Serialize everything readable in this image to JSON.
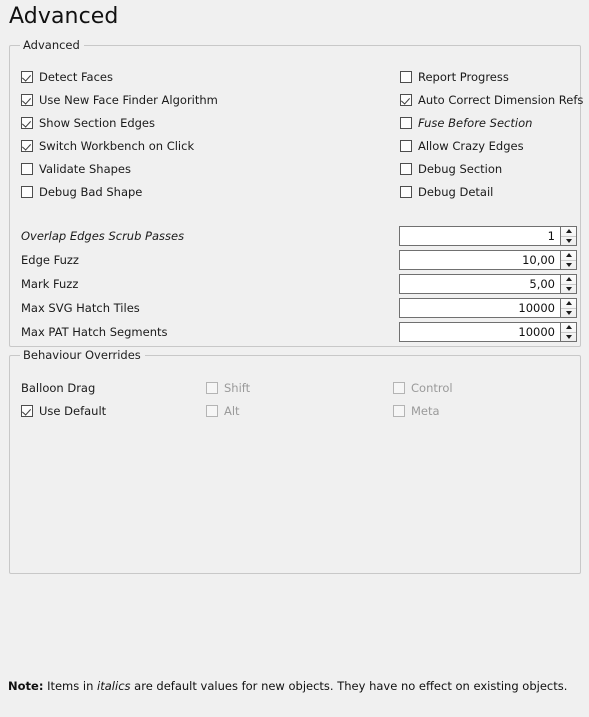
{
  "page": {
    "title": "Advanced"
  },
  "advanced_group": {
    "title": "Advanced",
    "checkboxes_left": [
      {
        "label": "Detect Faces",
        "checked": true,
        "italic": false,
        "disabled": false
      },
      {
        "label": "Use New Face Finder Algorithm",
        "checked": true,
        "italic": false,
        "disabled": false
      },
      {
        "label": "Show Section Edges",
        "checked": true,
        "italic": false,
        "disabled": false
      },
      {
        "label": "Switch Workbench on Click",
        "checked": true,
        "italic": false,
        "disabled": false
      },
      {
        "label": "Validate Shapes",
        "checked": false,
        "italic": false,
        "disabled": false
      },
      {
        "label": "Debug Bad Shape",
        "checked": false,
        "italic": false,
        "disabled": false
      }
    ],
    "checkboxes_right": [
      {
        "label": "Report Progress",
        "checked": false,
        "italic": false,
        "disabled": false
      },
      {
        "label": "Auto Correct Dimension Refs",
        "checked": true,
        "italic": false,
        "disabled": false
      },
      {
        "label": "Fuse Before Section",
        "checked": false,
        "italic": true,
        "disabled": false
      },
      {
        "label": "Allow Crazy Edges",
        "checked": false,
        "italic": false,
        "disabled": false
      },
      {
        "label": "Debug Section",
        "checked": false,
        "italic": false,
        "disabled": false
      },
      {
        "label": "Debug Detail",
        "checked": false,
        "italic": false,
        "disabled": false
      }
    ],
    "spin_fields": [
      {
        "label": "Overlap Edges Scrub Passes",
        "value": "1",
        "italic": true
      },
      {
        "label": "Edge Fuzz",
        "value": "10,00",
        "italic": false
      },
      {
        "label": "Mark Fuzz",
        "value": "5,00",
        "italic": false
      },
      {
        "label": "Max SVG Hatch Tiles",
        "value": "10000",
        "italic": false
      },
      {
        "label": "Max PAT Hatch Segments",
        "value": "10000",
        "italic": false
      }
    ]
  },
  "behaviour_group": {
    "title": "Behaviour Overrides",
    "rows": [
      {
        "name": {
          "label": "Balloon Drag",
          "checkbox": false
        },
        "mid": {
          "label": "Shift",
          "checked": false,
          "disabled": true
        },
        "right": {
          "label": "Control",
          "checked": false,
          "disabled": true
        }
      },
      {
        "name": {
          "label": "Use Default",
          "checkbox": true,
          "checked": true
        },
        "mid": {
          "label": "Alt",
          "checked": false,
          "disabled": true
        },
        "right": {
          "label": "Meta",
          "checked": false,
          "disabled": true
        }
      }
    ]
  },
  "footer": {
    "note_prefix": "Note:",
    "note_part1": "Items in",
    "note_italic": "italics",
    "note_part2": "are default values for new objects. They have no effect on existing objects."
  },
  "colors": {
    "background": "#f0f0f0",
    "group_border": "#c8c8c8",
    "field_border": "#707070",
    "text": "#1a1a1a",
    "disabled_text": "#9a9a9a"
  }
}
